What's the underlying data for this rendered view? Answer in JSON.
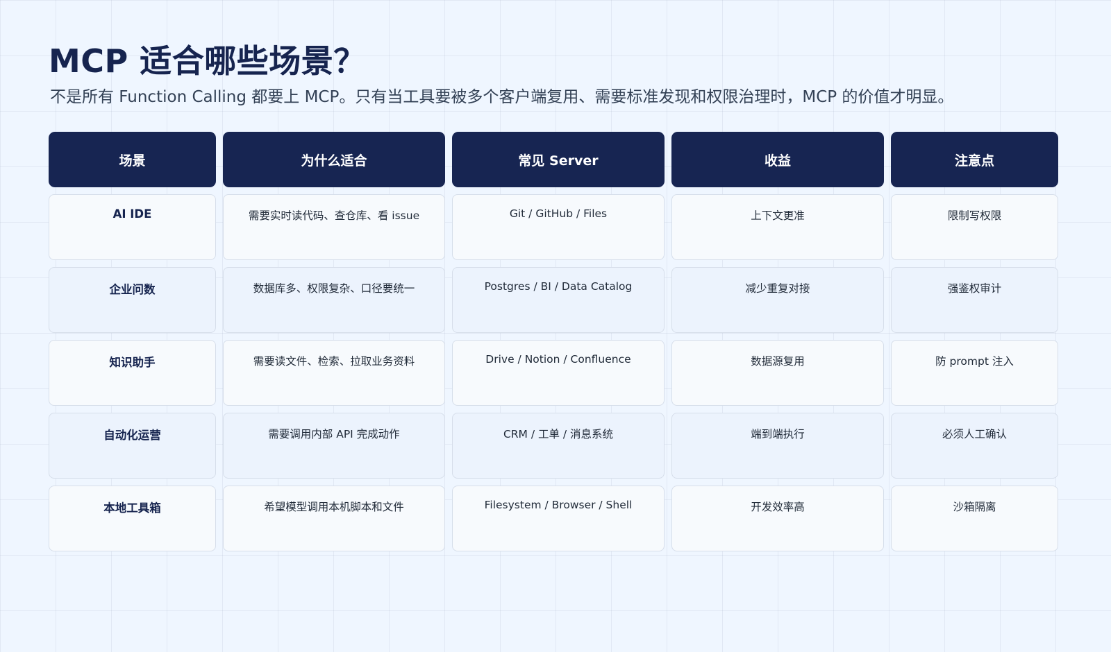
{
  "title": "MCP 适合哪些场景？",
  "subtitle": "不是所有 Function Calling 都要上 MCP。只有当工具要被多个客户端复用、需要标准发现和权限治理时，MCP 的价值才明显。",
  "table": {
    "headers": [
      "场景",
      "为什么适合",
      "常见 Server",
      "收益",
      "注意点"
    ],
    "rows": [
      [
        "AI IDE",
        "需要实时读代码、查仓库、看 issue",
        "Git / GitHub / Files",
        "上下文更准",
        "限制写权限"
      ],
      [
        "企业问数",
        "数据库多、权限复杂、口径要统一",
        "Postgres / BI / Data Catalog",
        "减少重复对接",
        "强鉴权审计"
      ],
      [
        "知识助手",
        "需要读文件、检索、拉取业务资料",
        "Drive / Notion / Confluence",
        "数据源复用",
        "防 prompt 注入"
      ],
      [
        "自动化运营",
        "需要调用内部 API 完成动作",
        "CRM / 工单 / 消息系统",
        "端到端执行",
        "必须人工确认"
      ],
      [
        "本地工具箱",
        "希望模型调用本机脚本和文件",
        "Filesystem / Browser / Shell",
        "开发效率高",
        "沙箱隔离"
      ]
    ]
  },
  "colors": {
    "header_bg": "#172552",
    "title": "#16244f",
    "page_bg": "#eff6ff"
  }
}
